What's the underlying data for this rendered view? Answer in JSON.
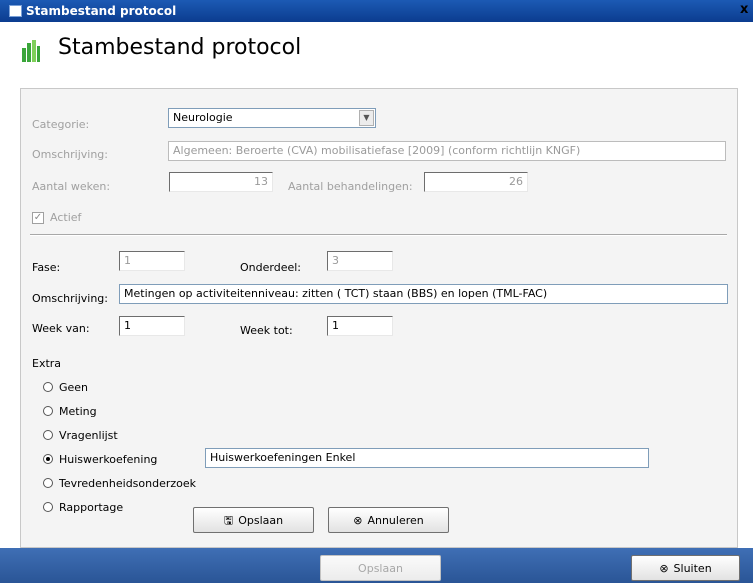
{
  "window": {
    "title": "Stambestand protocol",
    "close_glyph": "x"
  },
  "header": {
    "title": "Stambestand protocol",
    "icon": "grid-chart-icon"
  },
  "protocol": {
    "categorie_label": "Categorie:",
    "categorie_value": "Neurologie",
    "omschrijving_label": "Omschrijving:",
    "omschrijving_value": "Algemeen: Beroerte (CVA) mobilisatiefase [2009] (conform richtlijn KNGF)",
    "aantal_weken_label": "Aantal weken:",
    "aantal_weken_value": "13",
    "aantal_behandelingen_label": "Aantal behandelingen:",
    "aantal_behandelingen_value": "26",
    "actief_label": "Actief",
    "actief_checked": true
  },
  "onderdeel": {
    "fase_label": "Fase:",
    "fase_value": "1",
    "onderdeel_label": "Onderdeel:",
    "onderdeel_value": "3",
    "omschrijving_label": "Omschrijving:",
    "omschrijving_value": "Metingen op activiteitenniveau: zitten ( TCT) staan (BBS) en lopen (TML-FAC)",
    "week_van_label": "Week van:",
    "week_van_value": "1",
    "week_tot_label": "Week tot:",
    "week_tot_value": "1"
  },
  "extra": {
    "label": "Extra",
    "options": [
      {
        "label": "Geen",
        "selected": false
      },
      {
        "label": "Meting",
        "selected": false
      },
      {
        "label": "Vragenlijst",
        "selected": false
      },
      {
        "label": "Huiswerkoefening",
        "selected": true
      },
      {
        "label": "Tevredenheidsonderzoek",
        "selected": false
      },
      {
        "label": "Rapportage",
        "selected": false
      }
    ],
    "huiswerk_value": "Huiswerkoefeningen Enkel"
  },
  "buttons": {
    "opslaan_label": "Opslaan",
    "annuleren_label": "Annuleren",
    "footer_opslaan_label": "Opslaan",
    "sluiten_label": "Sluiten"
  },
  "colors": {
    "titlebar": "#0b3c8f",
    "footer": "#2a5596",
    "panel": "#f4f4f4"
  }
}
